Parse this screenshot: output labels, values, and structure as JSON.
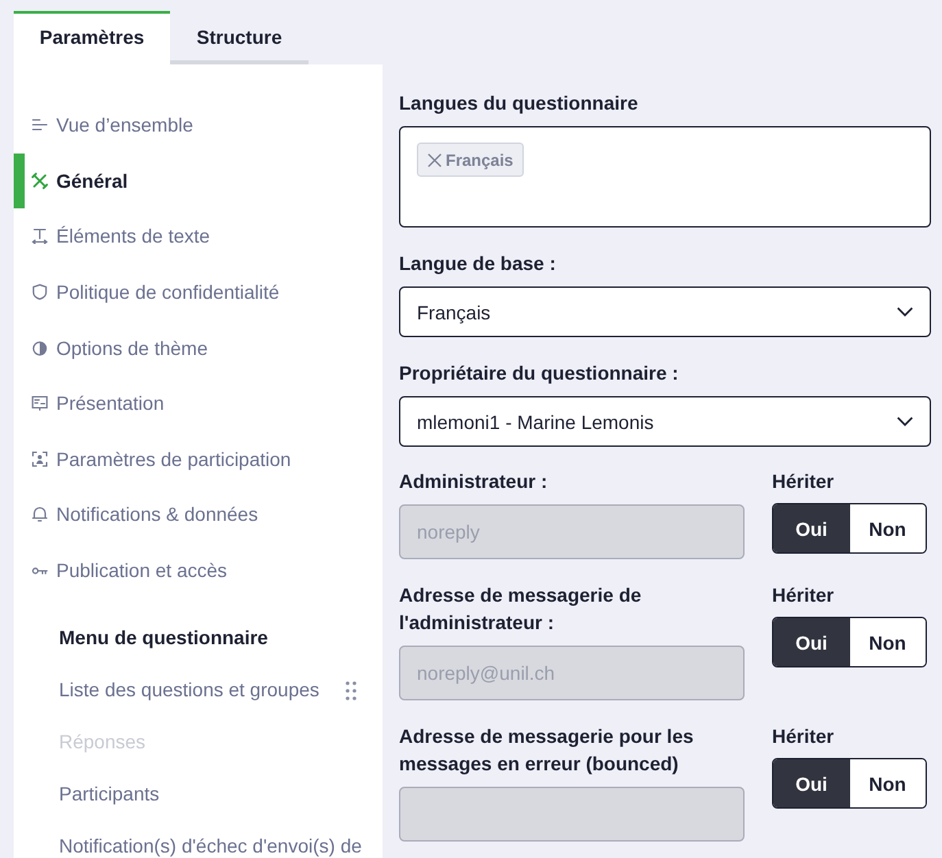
{
  "tabs": [
    {
      "label": "Paramètres",
      "selected": true
    },
    {
      "label": "Structure",
      "selected": false
    }
  ],
  "sidebar": {
    "items": [
      {
        "label": "Vue d’ensemble",
        "selected": false
      },
      {
        "label": "Général",
        "selected": true
      },
      {
        "label": "Éléments de texte",
        "selected": false
      },
      {
        "label": "Politique de confidentialité",
        "selected": false
      },
      {
        "label": "Options de thème",
        "selected": false
      },
      {
        "label": "Présentation",
        "selected": false
      },
      {
        "label": "Paramètres de participation",
        "selected": false
      },
      {
        "label": "Notifications & données",
        "selected": false
      },
      {
        "label": "Publication et accès",
        "selected": false
      }
    ],
    "menu": {
      "title": "Menu de questionnaire",
      "items": [
        {
          "label": "Liste des questions et groupes",
          "disabled": false,
          "handle": true
        },
        {
          "label": "Réponses",
          "disabled": true,
          "handle": false
        },
        {
          "label": "Participants",
          "disabled": false,
          "handle": false
        },
        {
          "label": "Notification(s) d'échec d'envoi(s) de",
          "disabled": false,
          "handle": false
        }
      ]
    }
  },
  "form": {
    "languages": {
      "label": "Langues du questionnaire",
      "tags": [
        "Français"
      ]
    },
    "base_language": {
      "label": "Langue de base :",
      "value": "Français"
    },
    "owner": {
      "label": "Propriétaire du questionnaire :",
      "value": "mlemoni1 - Marine Lemonis"
    },
    "inherited_fields": [
      {
        "label": "Administrateur :",
        "placeholder": "noreply",
        "disabled": true,
        "inherit": {
          "label": "Hériter",
          "options": [
            {
              "label": "Oui",
              "selected": true
            },
            {
              "label": "Non",
              "selected": false
            }
          ]
        }
      },
      {
        "label": "Adresse de messagerie de l'administrateur :",
        "placeholder": "noreply@unil.ch",
        "disabled": true,
        "inherit": {
          "label": "Hériter",
          "options": [
            {
              "label": "Oui",
              "selected": true
            },
            {
              "label": "Non",
              "selected": false
            }
          ]
        }
      },
      {
        "label": "Adresse de messagerie pour les messages en erreur (bounced)",
        "disabled": true,
        "inherit": {
          "label": "Hériter",
          "options": [
            {
              "label": "Oui",
              "selected": true
            },
            {
              "label": "Non",
              "selected": false
            }
          ]
        }
      }
    ]
  }
}
